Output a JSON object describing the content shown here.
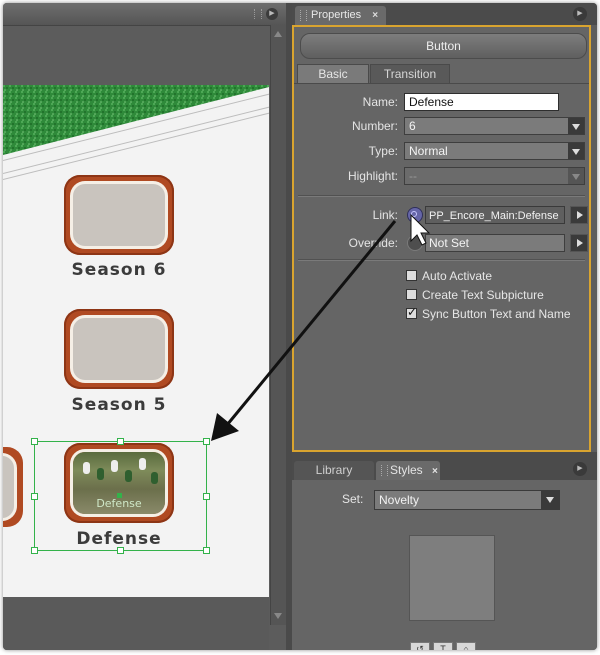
{
  "canvas": {
    "buttons": [
      {
        "label": "Season 6"
      },
      {
        "label": "Season 5"
      },
      {
        "label": "Defense",
        "caption": "Defense"
      }
    ]
  },
  "properties": {
    "tab_label": "Properties",
    "close_glyph": "×",
    "object_type": "Button",
    "tabs": [
      "Basic",
      "Transition"
    ],
    "name_label": "Name:",
    "name_value": "Defense",
    "number_label": "Number:",
    "number_value": "6",
    "type_label": "Type:",
    "type_value": "Normal",
    "highlight_label": "Highlight:",
    "highlight_value": "--",
    "link_label": "Link:",
    "link_value": "PP_Encore_Main:Defense",
    "override_label": "Override:",
    "override_value": "Not Set",
    "checkboxes": [
      {
        "label": "Auto Activate",
        "checked": false
      },
      {
        "label": "Create Text Subpicture",
        "checked": false
      },
      {
        "label": "Sync Button Text and Name",
        "checked": true
      }
    ]
  },
  "styles_panel": {
    "tabs": [
      "Library",
      "Styles"
    ],
    "close_glyph": "×",
    "set_label": "Set:",
    "set_value": "Novelty"
  },
  "colors": {
    "accent_border": "#d9a42f",
    "selection": "#33b24a",
    "button_frame": "#b04a22",
    "arrow": "#111111"
  }
}
